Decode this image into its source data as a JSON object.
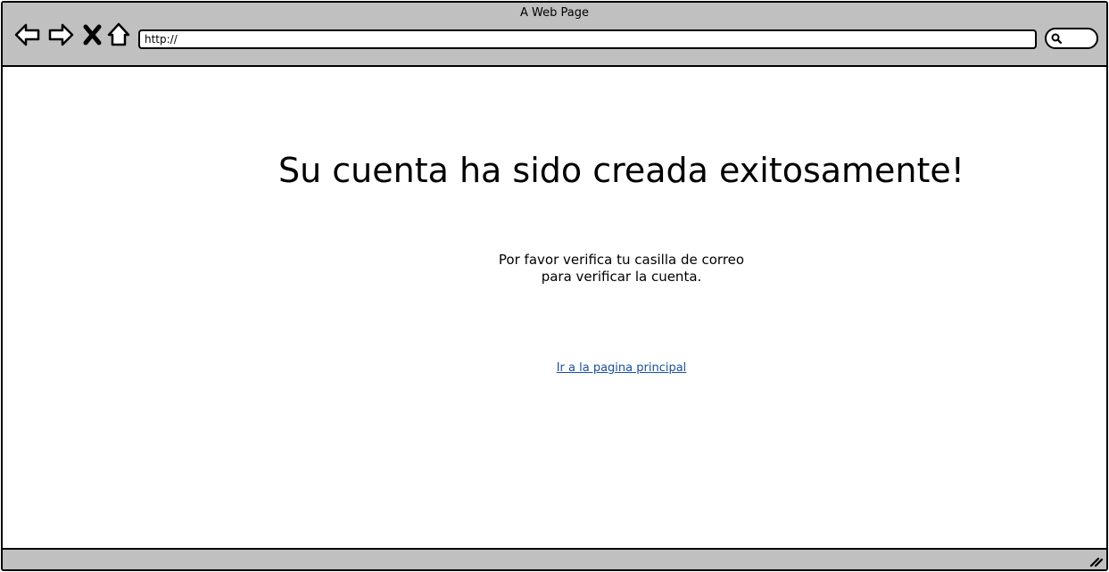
{
  "window": {
    "title": "A Web Page",
    "address": "http://"
  },
  "icons": {
    "back": "back-arrow-icon",
    "forward": "forward-arrow-icon",
    "stop": "close-icon",
    "home": "home-icon",
    "search": "search-icon",
    "resize": "resize-grip-icon"
  },
  "content": {
    "heading": "Su cuenta ha sido creada exitosamente!",
    "message_line1": "Por favor verifica tu casilla de correo",
    "message_line2": "para verificar la cuenta.",
    "home_link": "Ir a la pagina principal"
  },
  "colors": {
    "chrome": "#c0c0c0",
    "link": "#1a4f9c"
  }
}
